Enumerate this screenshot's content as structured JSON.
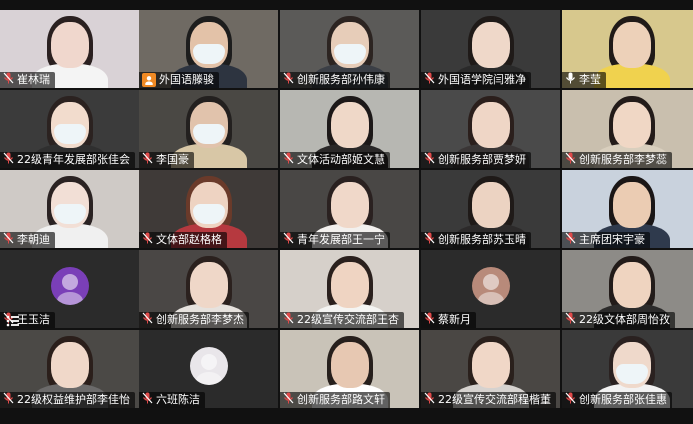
{
  "participants": [
    {
      "name": "崔林瑞",
      "mic": "muted",
      "scene": "person",
      "bg": "#d9d2d6",
      "skin": "#f0d7cd",
      "hair": "#2a2020",
      "body": "#f4f4f4",
      "mask": false
    },
    {
      "name": "外国语滕骏",
      "mic": "host",
      "scene": "person",
      "bg": "#6f6a63",
      "skin": "#e3c2a8",
      "hair": "#1d1d1d",
      "body": "#2d3440",
      "mask": true
    },
    {
      "name": "创新服务部孙伟康",
      "mic": "muted",
      "scene": "person",
      "bg": "#5b5a58",
      "skin": "#e7cdb9",
      "hair": "#2c2421",
      "body": "#3b3f46",
      "mask": true
    },
    {
      "name": "外国语学院闫雅净",
      "mic": "muted",
      "scene": "person",
      "bg": "#3a3a3a",
      "skin": "#efd8c9",
      "hair": "#1f1a18",
      "body": "#2a2a2a",
      "mask": false
    },
    {
      "name": "李莹",
      "mic": "on",
      "scene": "person",
      "bg": "#d7c88d",
      "skin": "#edd1b9",
      "hair": "#201a18",
      "body": "#f0d24e",
      "mask": false,
      "active": true
    },
    {
      "name": "22级青年发展部张佳会",
      "mic": "muted",
      "scene": "person",
      "bg": "#3b3b3b",
      "skin": "#f2dccd",
      "hair": "#2b2220",
      "body": "#2f2f2f",
      "mask": true
    },
    {
      "name": "李国豪",
      "mic": "muted",
      "scene": "person",
      "bg": "#4a4844",
      "skin": "#e1c3ac",
      "hair": "#23201f",
      "body": "#d8c7a6",
      "mask": true
    },
    {
      "name": "文体活动部姬文慧",
      "mic": "muted",
      "scene": "person",
      "bg": "#b7b7b2",
      "skin": "#efd8c8",
      "hair": "#1c1818",
      "body": "#2a2828",
      "mask": false
    },
    {
      "name": "创新服务部贾梦妍",
      "mic": "muted",
      "scene": "person",
      "bg": "#4a4a4a",
      "skin": "#efd6c6",
      "hair": "#2b1f1c",
      "body": "#3a3636",
      "mask": false
    },
    {
      "name": "创新服务部李梦蕊",
      "mic": "muted",
      "scene": "person",
      "bg": "#c9bfae",
      "skin": "#f0d7c5",
      "hair": "#231b19",
      "body": "#d9cfbe",
      "mask": false
    },
    {
      "name": "李朝迪",
      "mic": "muted",
      "scene": "person",
      "bg": "#cfcac6",
      "skin": "#f2dfd6",
      "hair": "#2a2222",
      "body": "#f0f0f0",
      "mask": true
    },
    {
      "name": "文体部赵格格",
      "mic": "muted",
      "scene": "person",
      "bg": "#3f3a38",
      "skin": "#eed3c2",
      "hair": "#6a3a2a",
      "body": "#b6393f",
      "mask": true
    },
    {
      "name": "青年发展部王一宁",
      "mic": "muted",
      "scene": "person",
      "bg": "#494745",
      "skin": "#f0d8c9",
      "hair": "#2a2120",
      "body": "#f2f0ee",
      "mask": false
    },
    {
      "name": "创新服务部苏玉晴",
      "mic": "muted",
      "scene": "person",
      "bg": "#3a3a3a",
      "skin": "#ecd3c2",
      "hair": "#1f1a18",
      "body": "#2c2a2a",
      "mask": false
    },
    {
      "name": "主席团宋宇豪",
      "mic": "muted",
      "scene": "person",
      "bg": "#c9d2dd",
      "skin": "#ebccb3",
      "hair": "#1a1616",
      "body": "#2f3a4d",
      "mask": false
    },
    {
      "name": "王玉洁",
      "mic": "muted",
      "scene": "avatar",
      "bg": "#2b2b2b",
      "avatar": "#7a3fb8"
    },
    {
      "name": "创新服务部李梦杰",
      "mic": "muted",
      "scene": "person",
      "bg": "#4a4745",
      "skin": "#efd7c8",
      "hair": "#2b211e",
      "body": "#e6e2de",
      "mask": false
    },
    {
      "name": "22级宣传交流部王杏",
      "mic": "muted",
      "scene": "person",
      "bg": "#d6d0ca",
      "skin": "#efd4c2",
      "hair": "#2a201d",
      "body": "#f4f4f2",
      "mask": false
    },
    {
      "name": "蔡新月",
      "mic": "muted",
      "scene": "avatar",
      "bg": "#2b2b2b",
      "avatar": "#b88a7a"
    },
    {
      "name": "22级文体部周怡孜",
      "mic": "muted",
      "scene": "person",
      "bg": "#8d8b87",
      "skin": "#efd4c0",
      "hair": "#221b19",
      "body": "#2c2b2b",
      "mask": false
    },
    {
      "name": "22级权益维护部李佳怡",
      "mic": "muted",
      "scene": "person",
      "bg": "#4b4946",
      "skin": "#f0d8c9",
      "hair": "#2b1f1b",
      "body": "#6b6a6a",
      "mask": false
    },
    {
      "name": "六班陈洁",
      "mic": "muted",
      "scene": "avatar",
      "bg": "#2b2b2b",
      "avatar": "#e9e6ea"
    },
    {
      "name": "创新服务部路文轩",
      "mic": "muted",
      "scene": "person",
      "bg": "#c9c3b8",
      "skin": "#e7c8b2",
      "hair": "#261f1c",
      "body": "#ffffff",
      "mask": false
    },
    {
      "name": "22级宣传交流部程楷董",
      "mic": "muted",
      "scene": "person",
      "bg": "#4a4744",
      "skin": "#f0d7c7",
      "hair": "#2a201c",
      "body": "#d6d2cf",
      "mask": false
    },
    {
      "name": "创新服务部张佳惠",
      "mic": "muted",
      "scene": "person",
      "bg": "#3a3a3a",
      "skin": "#efd9cb",
      "hair": "#2a2120",
      "body": "#f2f2f2",
      "mask": true
    }
  ],
  "more_icon": "more-icon",
  "colors": {
    "active_border": "#2f9e58",
    "muted_mic": "#e04a4a",
    "host_badge": "#f08a24"
  }
}
